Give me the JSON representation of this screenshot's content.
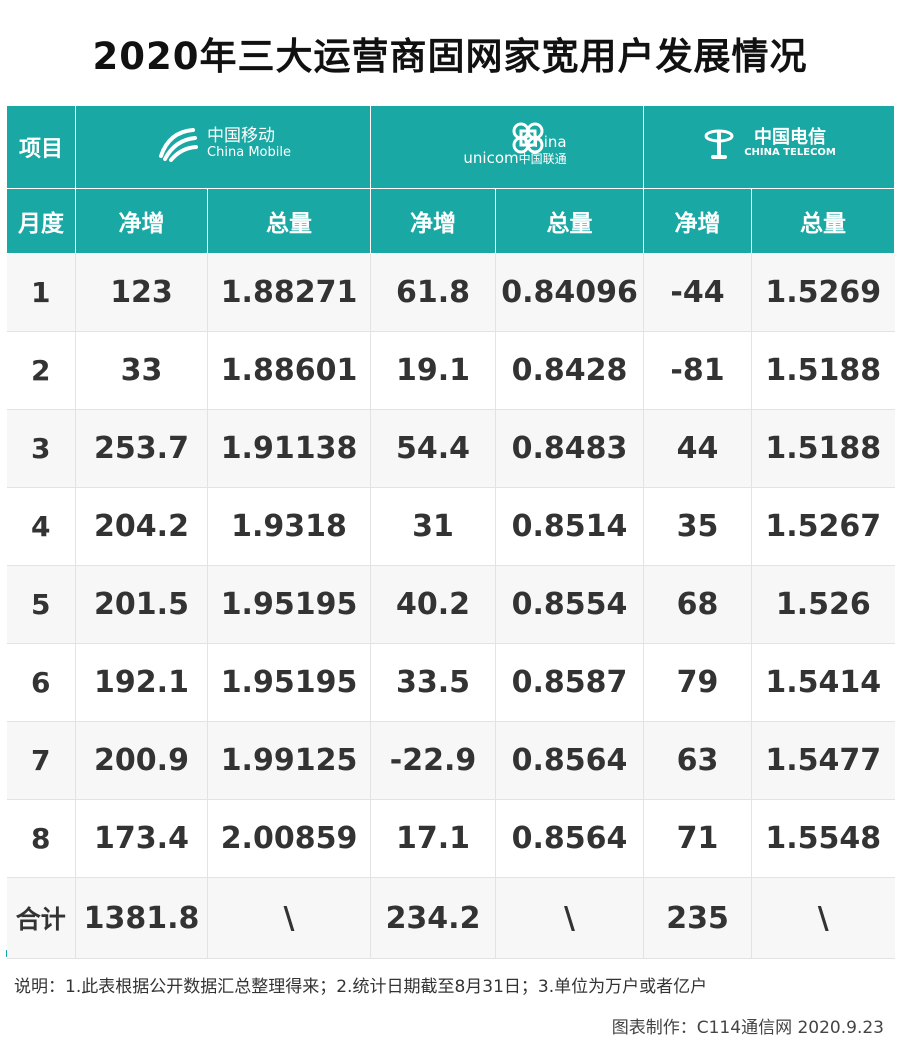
{
  "title": "2020年三大运营商固网家宽用户发展情况",
  "header": {
    "item_label": "项目",
    "month_label": "月度",
    "operators": [
      {
        "cn": "中国移动",
        "en": "China Mobile",
        "logo_icon": "china-mobile-logo-icon"
      },
      {
        "cn": "中国联通",
        "en_top": "China",
        "en_bottom": "unicom",
        "logo_icon": "china-unicom-logo-icon"
      },
      {
        "cn": "中国电信",
        "en": "CHINA TELECOM",
        "logo_icon": "china-telecom-logo-icon"
      }
    ],
    "net_label": "净增",
    "total_label": "总量"
  },
  "rows": [
    {
      "month": "1",
      "cm_net": "123",
      "cm_total": "1.88271",
      "cu_net": "61.8",
      "cu_total": "0.84096",
      "ct_net": "-44",
      "ct_total": "1.5269"
    },
    {
      "month": "2",
      "cm_net": "33",
      "cm_total": "1.88601",
      "cu_net": "19.1",
      "cu_total": "0.8428",
      "ct_net": "-81",
      "ct_total": "1.5188"
    },
    {
      "month": "3",
      "cm_net": "253.7",
      "cm_total": "1.91138",
      "cu_net": "54.4",
      "cu_total": "0.8483",
      "ct_net": "44",
      "ct_total": "1.5188"
    },
    {
      "month": "4",
      "cm_net": "204.2",
      "cm_total": "1.9318",
      "cu_net": "31",
      "cu_total": "0.8514",
      "ct_net": "35",
      "ct_total": "1.5267"
    },
    {
      "month": "5",
      "cm_net": "201.5",
      "cm_total": "1.95195",
      "cu_net": "40.2",
      "cu_total": "0.8554",
      "ct_net": "68",
      "ct_total": "1.526"
    },
    {
      "month": "6",
      "cm_net": "192.1",
      "cm_total": "1.95195",
      "cu_net": "33.5",
      "cu_total": "0.8587",
      "ct_net": "79",
      "ct_total": "1.5414"
    },
    {
      "month": "7",
      "cm_net": "200.9",
      "cm_total": "1.99125",
      "cu_net": "-22.9",
      "cu_total": "0.8564",
      "ct_net": "63",
      "ct_total": "1.5477"
    },
    {
      "month": "8",
      "cm_net": "173.4",
      "cm_total": "2.00859",
      "cu_net": "17.1",
      "cu_total": "0.8564",
      "ct_net": "71",
      "ct_total": "1.5548"
    }
  ],
  "summary": {
    "label": "合计",
    "cm_net": "1381.8",
    "cm_total": "\\",
    "cu_net": "234.2",
    "cu_total": "\\",
    "ct_net": "235",
    "ct_total": "\\"
  },
  "footer": {
    "note": "说明：1.此表根据公开数据汇总整理得来；2.统计日期截至8月31日；3.单位为万户或者亿户",
    "credit": "图表制作：C114通信网  2020.9.23"
  },
  "colors": {
    "header_bg": "#19a8a4",
    "header_text": "#ffffff",
    "telecom_red": "#e60012"
  }
}
